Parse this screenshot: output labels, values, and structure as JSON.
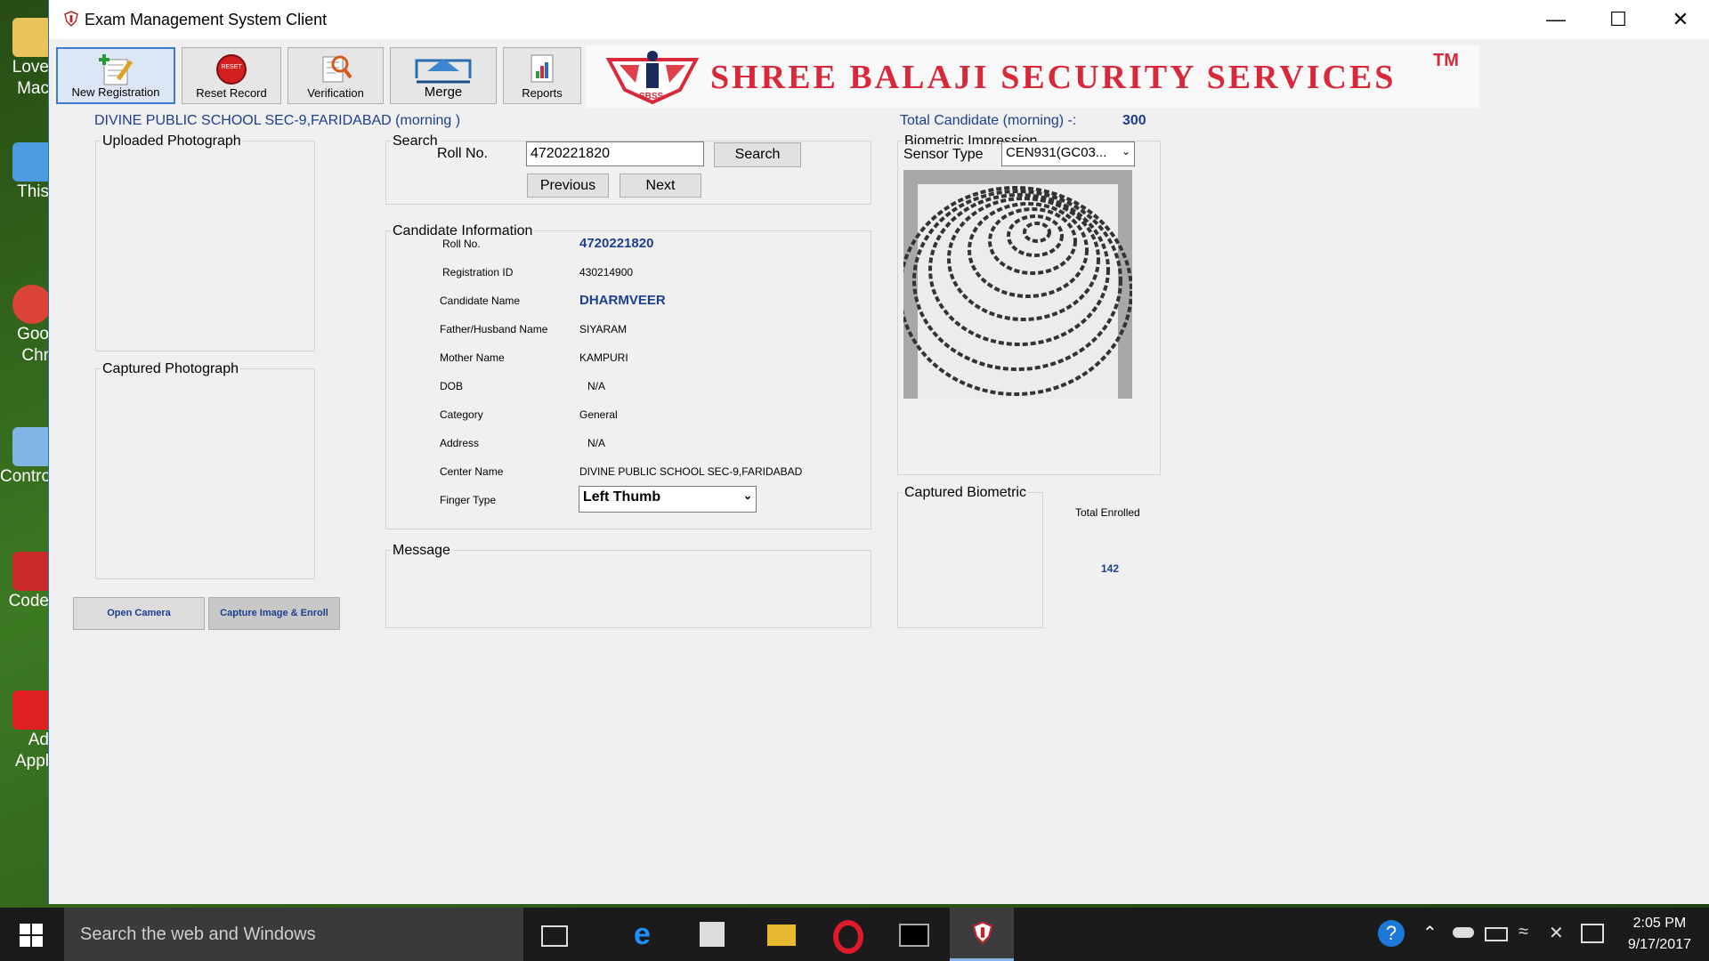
{
  "window": {
    "title": "Exam Management System Client"
  },
  "toolbar": {
    "new_registration": "New Registration",
    "reset_record": "Reset Record",
    "reset_badge": "RESET",
    "verification": "Verification",
    "merge": "Merge",
    "reports": "Reports"
  },
  "banner": {
    "text": "SHREE BALAJI SECURITY SERVICES",
    "tm": "TM",
    "logo_text": "SBSS"
  },
  "center_header": "DIVINE PUBLIC SCHOOL SEC-9,FARIDABAD (morning )",
  "total_candidate": {
    "label": "Total Candidate (morning) -:",
    "value": "300"
  },
  "photos": {
    "uploaded_title": "Uploaded Photograph",
    "captured_title": "Captured Photograph",
    "open_camera": "Open Camera",
    "capture_enroll": "Capture Image & Enroll"
  },
  "search": {
    "group_title": "Search",
    "roll_label": "Roll No.",
    "roll_value": "4720221820",
    "search_button": "Search",
    "previous_button": "Previous",
    "next_button": "Next"
  },
  "candidate": {
    "group_title": "Candidate Information",
    "fields": [
      {
        "label": "Roll No.",
        "value": "4720221820"
      },
      {
        "label": "Registration ID",
        "value": "430214900"
      },
      {
        "label": "Candidate Name",
        "value": "DHARMVEER"
      },
      {
        "label": "Father/Husband Name",
        "value": "SIYARAM"
      },
      {
        "label": "Mother Name",
        "value": "KAMPURI"
      },
      {
        "label": "DOB",
        "value": "N/A"
      },
      {
        "label": "Category",
        "value": "General"
      },
      {
        "label": "Address",
        "value": "N/A"
      },
      {
        "label": "Center Name",
        "value": "DIVINE PUBLIC SCHOOL SEC-9,FARIDABAD"
      },
      {
        "label": "Finger Type",
        "value": "Left Thumb"
      }
    ]
  },
  "message": {
    "group_title": "Message"
  },
  "biometric": {
    "group_title": "Biometric Impression",
    "sensor_label": "Sensor Type",
    "sensor_value": "CEN931(GC03...",
    "captured_title": "Captured Biometric",
    "total_enrolled_label": "Total Enrolled",
    "total_enrolled_value": "142"
  },
  "desktop_icons": [
    "Love",
    "Mac",
    "This",
    "Goo",
    "Chr",
    "Contro",
    "Code",
    "Ad",
    "Appl"
  ],
  "taskbar": {
    "search_placeholder": "Search the web and Windows",
    "time": "2:05 PM",
    "date": "9/17/2017"
  },
  "colors": {
    "accent_blue": "#1c3f8f",
    "banner_red": "#d8283a"
  }
}
